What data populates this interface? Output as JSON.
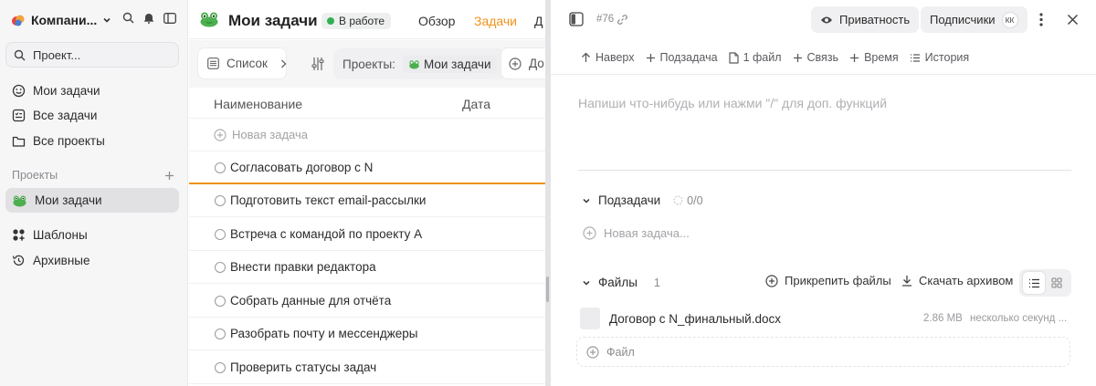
{
  "colors": {
    "accent": "#f0931a",
    "status_green": "#2fb152",
    "sidebar_bg": "#f6f6f7"
  },
  "sidebar": {
    "workspace_name": "Компани...",
    "search_placeholder": "Проект...",
    "nav": [
      {
        "label": "Мои задачи",
        "icon": "smile-icon"
      },
      {
        "label": "Все задачи",
        "icon": "checklist-icon"
      },
      {
        "label": "Все проекты",
        "icon": "folder-icon"
      }
    ],
    "section_label": "Проекты",
    "active_project": "Мои задачи",
    "bottom_nav": [
      {
        "label": "Шаблоны",
        "icon": "templates-icon"
      },
      {
        "label": "Архивные",
        "icon": "history-icon"
      }
    ]
  },
  "middle": {
    "title": "Мои задачи",
    "status": "В работе",
    "tabs": [
      "Обзор",
      "Задачи",
      "Д"
    ],
    "active_tab": "Задачи",
    "filters": {
      "view_label": "Список",
      "projects_label": "Проекты:",
      "project_tag": "Мои задачи",
      "add_label": "До"
    },
    "columns": [
      "Наименование",
      "Дата"
    ],
    "new_task_label": "Новая задача",
    "tasks": [
      "Согласовать договор с N",
      "Подготовить текст email-рассылки",
      "Встреча с командой по проекту А",
      "Внести правки редактора",
      "Собрать данные для отчёта",
      "Разобрать почту и мессенджеры",
      "Проверить статусы задач"
    ]
  },
  "detail": {
    "task_number": "#76",
    "privacy_label": "Приватность",
    "subscribers_label": "Подписчики",
    "subscriber_initials": "КК",
    "toolbar": {
      "up": "Наверх",
      "subtask": "Подзадача",
      "files": "1 файл",
      "link": "Связь",
      "time": "Время",
      "history": "История"
    },
    "editor_placeholder": "Напиши что-нибудь или нажми \"/\" для доп. функций",
    "subtasks": {
      "label": "Подзадачи",
      "count": "0/0",
      "new_placeholder": "Новая задача..."
    },
    "files": {
      "label": "Файлы",
      "count": "1",
      "attach_label": "Прикрепить файлы",
      "download_label": "Скачать архивом",
      "items": [
        {
          "name": "Договор с N_финальный.docx",
          "size": "2.86 MB",
          "time": "несколько секунд ..."
        }
      ],
      "drop_label": "Файл"
    }
  }
}
